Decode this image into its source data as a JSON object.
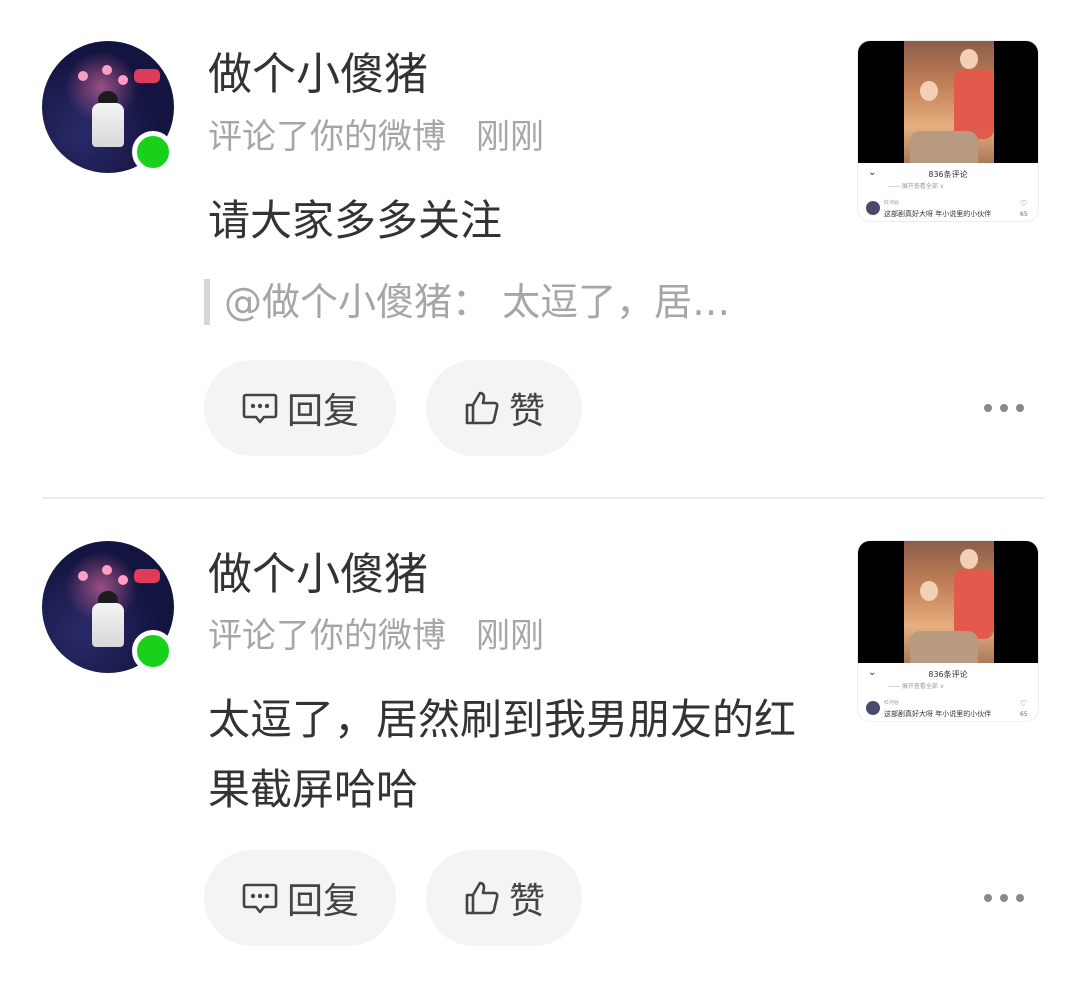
{
  "items": [
    {
      "username": "做个小傻猪",
      "action": "评论了你的微博",
      "time": "刚刚",
      "content": "请大家多多关注",
      "quote": "@做个小傻猪：  太逗了，居…",
      "reply_label": "回复",
      "like_label": "赞",
      "thumbnail": {
        "comment_count": "836条评论",
        "sub": "—— 展开查看全部 ∨",
        "commenter": "红河谷",
        "comment_text": "这部剧真好大呀  年小说里的小伙伴",
        "likes": "65"
      }
    },
    {
      "username": "做个小傻猪",
      "action": "评论了你的微博",
      "time": "刚刚",
      "content": "太逗了，居然刷到我男朋友的红果截屏哈哈",
      "reply_label": "回复",
      "like_label": "赞",
      "thumbnail": {
        "comment_count": "836条评论",
        "sub": "—— 展开查看全部 ∨",
        "commenter": "红河谷",
        "comment_text": "这部剧真好大呀  年小说里的小伙伴",
        "likes": "65"
      }
    }
  ],
  "colors": {
    "online": "#19d11b",
    "button_bg": "#f4f4f4",
    "secondary_text": "#a6a6a6"
  },
  "icons": [
    "comment-icon",
    "thumbs-up-icon",
    "more-icon",
    "chevron-down-icon",
    "heart-icon"
  ]
}
